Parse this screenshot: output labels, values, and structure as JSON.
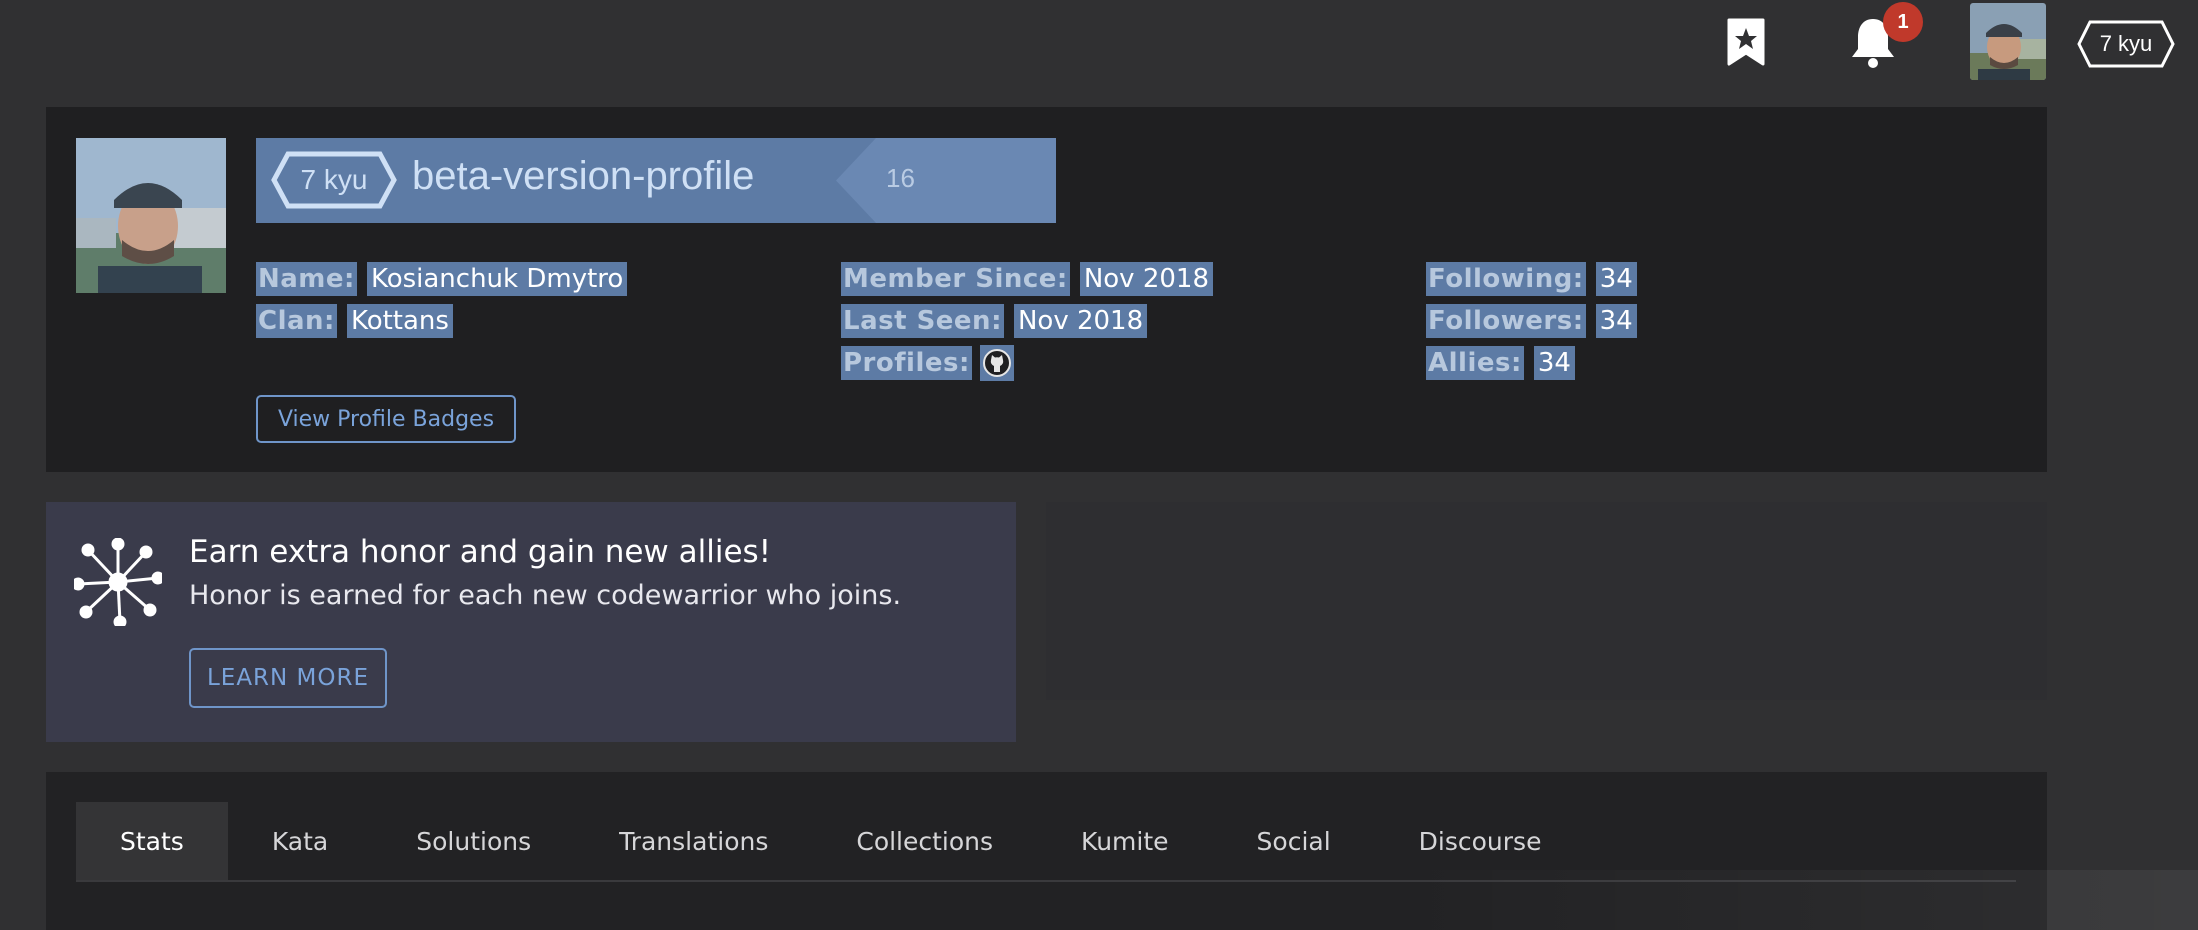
{
  "header": {
    "notification_count": "1",
    "rank": "7 kyu",
    "icons": [
      "bookmark-star-icon",
      "bell-icon"
    ]
  },
  "profile": {
    "rank": "7 kyu",
    "username": "beta-version-profile",
    "honor": "16",
    "name_label": "Name:",
    "name": "Kosianchuk Dmytro",
    "clan_label": "Clan:",
    "clan": "Kottans",
    "member_since_label": "Member Since:",
    "member_since": "Nov 2018",
    "last_seen_label": "Last Seen:",
    "last_seen": "Nov 2018",
    "profiles_label": "Profiles:",
    "profile_icons": [
      "github-icon"
    ],
    "following_label": "Following:",
    "following": "34",
    "followers_label": "Followers:",
    "followers": "34",
    "allies_label": "Allies:",
    "allies": "34",
    "badges_button": "View Profile Badges",
    "highlight_color": "#5d7ba5"
  },
  "promo": {
    "title": "Earn extra honor and gain new allies!",
    "subtitle": "Honor is earned for each new codewarrior who joins.",
    "button": "LEARN MORE"
  },
  "tabs": [
    {
      "label": "Stats",
      "active": true
    },
    {
      "label": "Kata",
      "active": false
    },
    {
      "label": "Solutions",
      "active": false
    },
    {
      "label": "Translations",
      "active": false
    },
    {
      "label": "Collections",
      "active": false
    },
    {
      "label": "Kumite",
      "active": false
    },
    {
      "label": "Social",
      "active": false
    },
    {
      "label": "Discourse",
      "active": false
    }
  ],
  "colors": {
    "background": "#303032",
    "card": "#1f1f21",
    "accent": "#6f95c9",
    "badge_red": "#c0392b"
  }
}
